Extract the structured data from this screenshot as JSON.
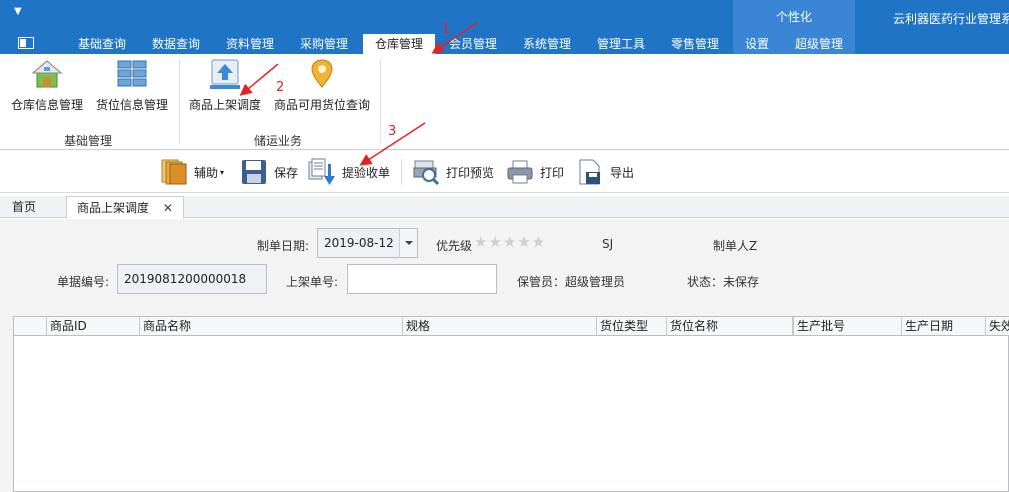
{
  "menubar": {
    "quick_access": "▼",
    "persona_label": "个性化",
    "app_title": "云利器医药行业管理系",
    "tabs": [
      {
        "label": "基础查询"
      },
      {
        "label": "数据查询"
      },
      {
        "label": "资料管理"
      },
      {
        "label": "采购管理"
      },
      {
        "label": "仓库管理"
      },
      {
        "label": "会员管理"
      },
      {
        "label": "系统管理"
      },
      {
        "label": "管理工具"
      },
      {
        "label": "零售管理"
      },
      {
        "label": "设置"
      },
      {
        "label": "超级管理"
      }
    ],
    "active_tab": "仓库管理"
  },
  "ribbon": {
    "groups": [
      {
        "label": "基础管理",
        "buttons": [
          {
            "label": "仓库信息管理",
            "icon": "warehouse-house-icon"
          },
          {
            "label": "货位信息管理",
            "icon": "shelf-grid-icon"
          }
        ]
      },
      {
        "label": "储运业务",
        "buttons": [
          {
            "label": "商品上架调度",
            "icon": "upload-arrow-icon"
          },
          {
            "label": "商品可用货位查询",
            "icon": "location-pin-icon"
          }
        ]
      }
    ]
  },
  "toolbar": {
    "assist_label": "辅助",
    "save_label": "保存",
    "inspect_label": "提验收单",
    "preview_label": "打印预览",
    "print_label": "打印",
    "export_label": "导出"
  },
  "doctabs": {
    "home_label": "首页",
    "active_label": "商品上架调度",
    "close_glyph": "✕"
  },
  "form": {
    "date_label": "制单日期:",
    "date_value": "2019-08-12",
    "priority_label": "优先级",
    "priority_stars": "★★★★★",
    "priority_value": 0,
    "code": "SJ",
    "creator_label": "制单人Z",
    "doc_no_label": "单据编号:",
    "doc_no_value": "2019081200000018",
    "shelf_no_label": "上架单号:",
    "shelf_no_value": "",
    "keeper_text": "保管员：超级管理员",
    "status_text": "状态：未保存"
  },
  "grid": {
    "columns": [
      "",
      "商品ID",
      "商品名称",
      "规格",
      "货位类型",
      "货位名称",
      "生产批号",
      "生产日期",
      "失效"
    ]
  },
  "annotations": [
    "1",
    "2",
    "3"
  ],
  "colors": {
    "menubar": "#1f74c6",
    "persona": "#3a86d4",
    "annotation": "#e52222"
  }
}
